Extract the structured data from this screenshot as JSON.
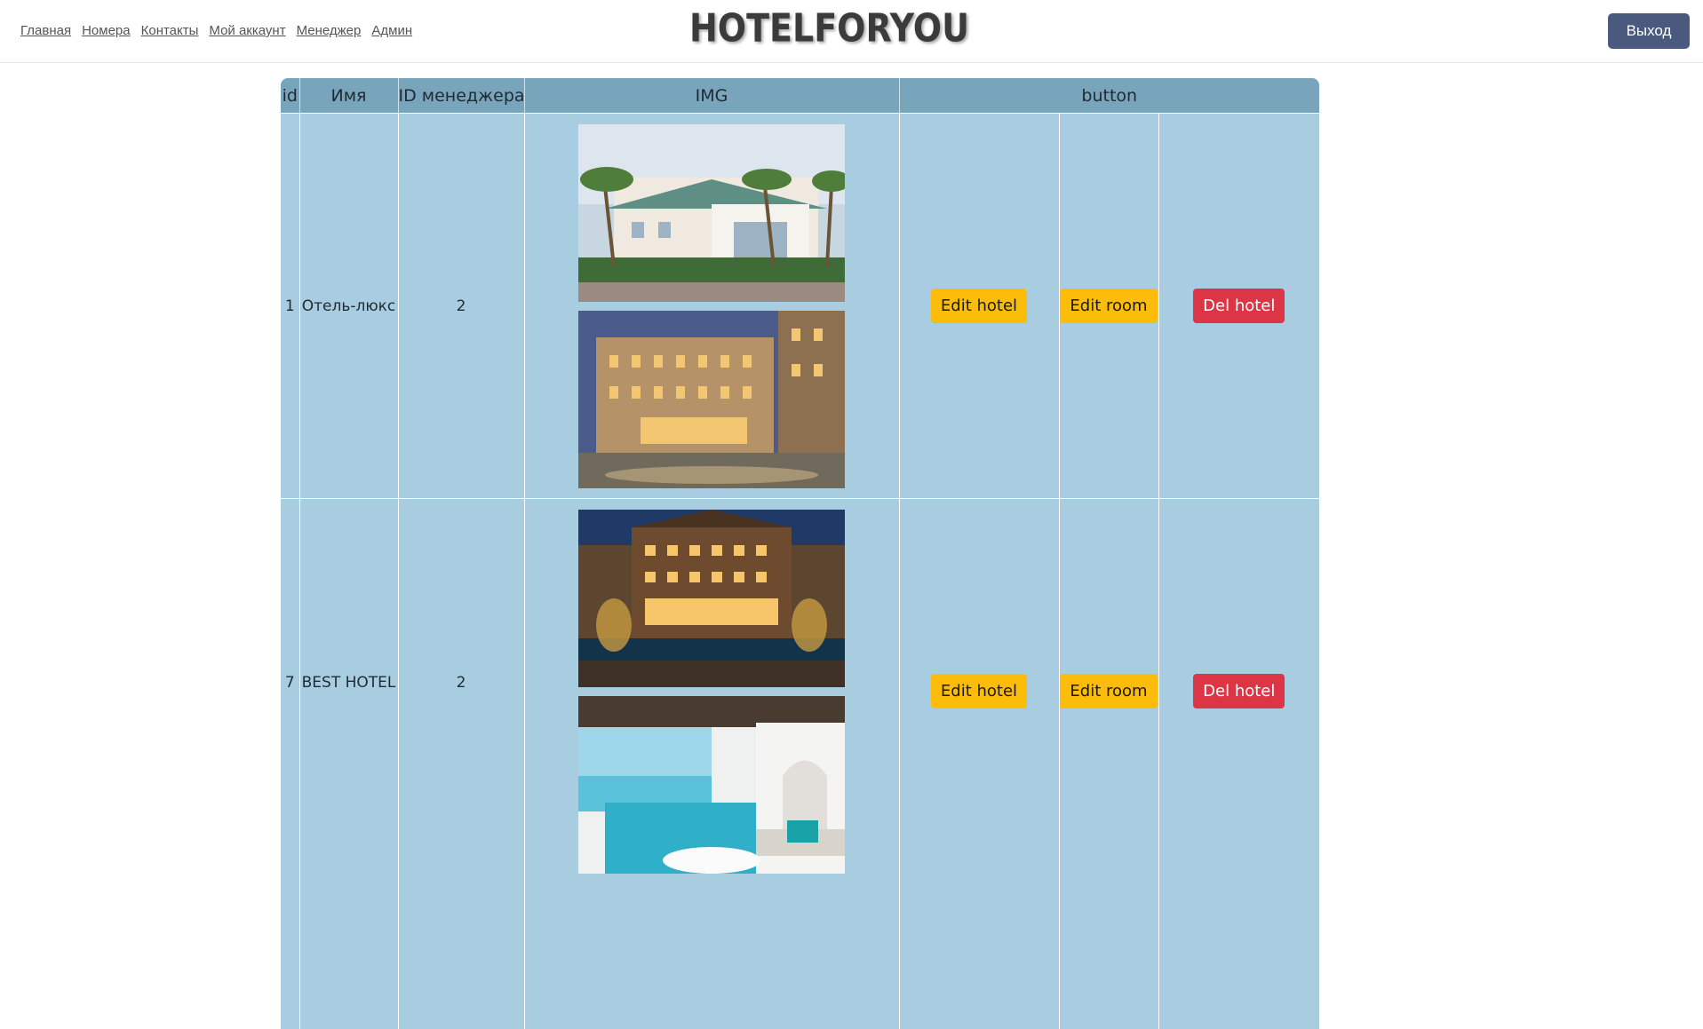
{
  "nav": {
    "links": [
      "Главная",
      "Номера",
      "Контакты",
      "Мой аккаунт",
      "Менеджер",
      "Админ"
    ]
  },
  "brand": {
    "logo_text": "HOTELFORYOU"
  },
  "header": {
    "logout_label": "Выход"
  },
  "table": {
    "columns": [
      "id",
      "Имя",
      "ID менеджера",
      "IMG",
      "button"
    ],
    "rows": [
      {
        "id": "1",
        "name": "Отель-люкс",
        "manager_id": "2",
        "actions": {
          "edit_hotel": "Edit hotel",
          "edit_room": "Edit room",
          "del_hotel": "Del hotel"
        }
      },
      {
        "id": "7",
        "name": "BEST HOTEL",
        "manager_id": "2",
        "actions": {
          "edit_hotel": "Edit hotel",
          "edit_room": "Edit room",
          "del_hotel": "Del hotel"
        }
      }
    ]
  },
  "colors": {
    "header_bg": "#78a4bc",
    "cell_bg": "#a9cde0",
    "warning": "#fbbc0a",
    "danger": "#dc3545",
    "logout_bg": "#4a5a7e"
  }
}
